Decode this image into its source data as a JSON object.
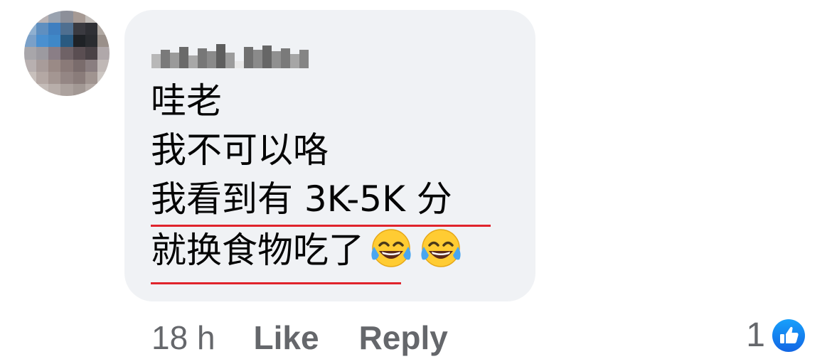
{
  "comment": {
    "lines": [
      "哇老",
      "我不可以咯",
      "我看到有 3K-5K 分",
      "就换食物吃了"
    ],
    "emojis": [
      "face-with-tears-of-joy-icon",
      "face-with-tears-of-joy-icon"
    ],
    "underline_color": "#e0242c"
  },
  "actions": {
    "time": "18 h",
    "like_label": "Like",
    "reply_label": "Reply"
  },
  "reactions": {
    "count": "1",
    "type": "like-reaction-icon",
    "color": "#1877f2"
  },
  "colors": {
    "bubble": "#f0f2f5",
    "text": "#050505",
    "meta": "#65676b"
  }
}
